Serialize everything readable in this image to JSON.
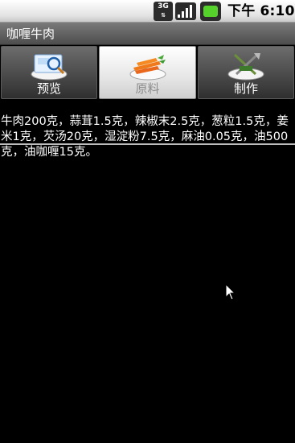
{
  "status_bar": {
    "network_label": "3G",
    "time": "下午 6:10",
    "icons": [
      "3g-icon",
      "signal-icon",
      "battery-icon"
    ]
  },
  "app": {
    "title": "咖喱牛肉"
  },
  "tabs": [
    {
      "label": "预览",
      "icon": "preview-dish-icon",
      "selected": false
    },
    {
      "label": "原料",
      "icon": "ingredients-carrot-icon",
      "selected": true
    },
    {
      "label": "制作",
      "icon": "cooking-utensils-icon",
      "selected": false
    }
  ],
  "content": {
    "ingredients_text": "牛肉200克，蒜茸1.5克，辣椒末2.5克，葱粒1.5克，姜米1克，芡汤20克，湿淀粉7.5克，麻油0.05克，油500克，油咖喱15克。"
  },
  "colors": {
    "background": "#000000",
    "status_bar": "#e4e4e4",
    "title_bar": "#5a5a5a",
    "selected_tab": "#ffffff",
    "unselected_tab": "#444444",
    "battery": "#56d32a"
  }
}
